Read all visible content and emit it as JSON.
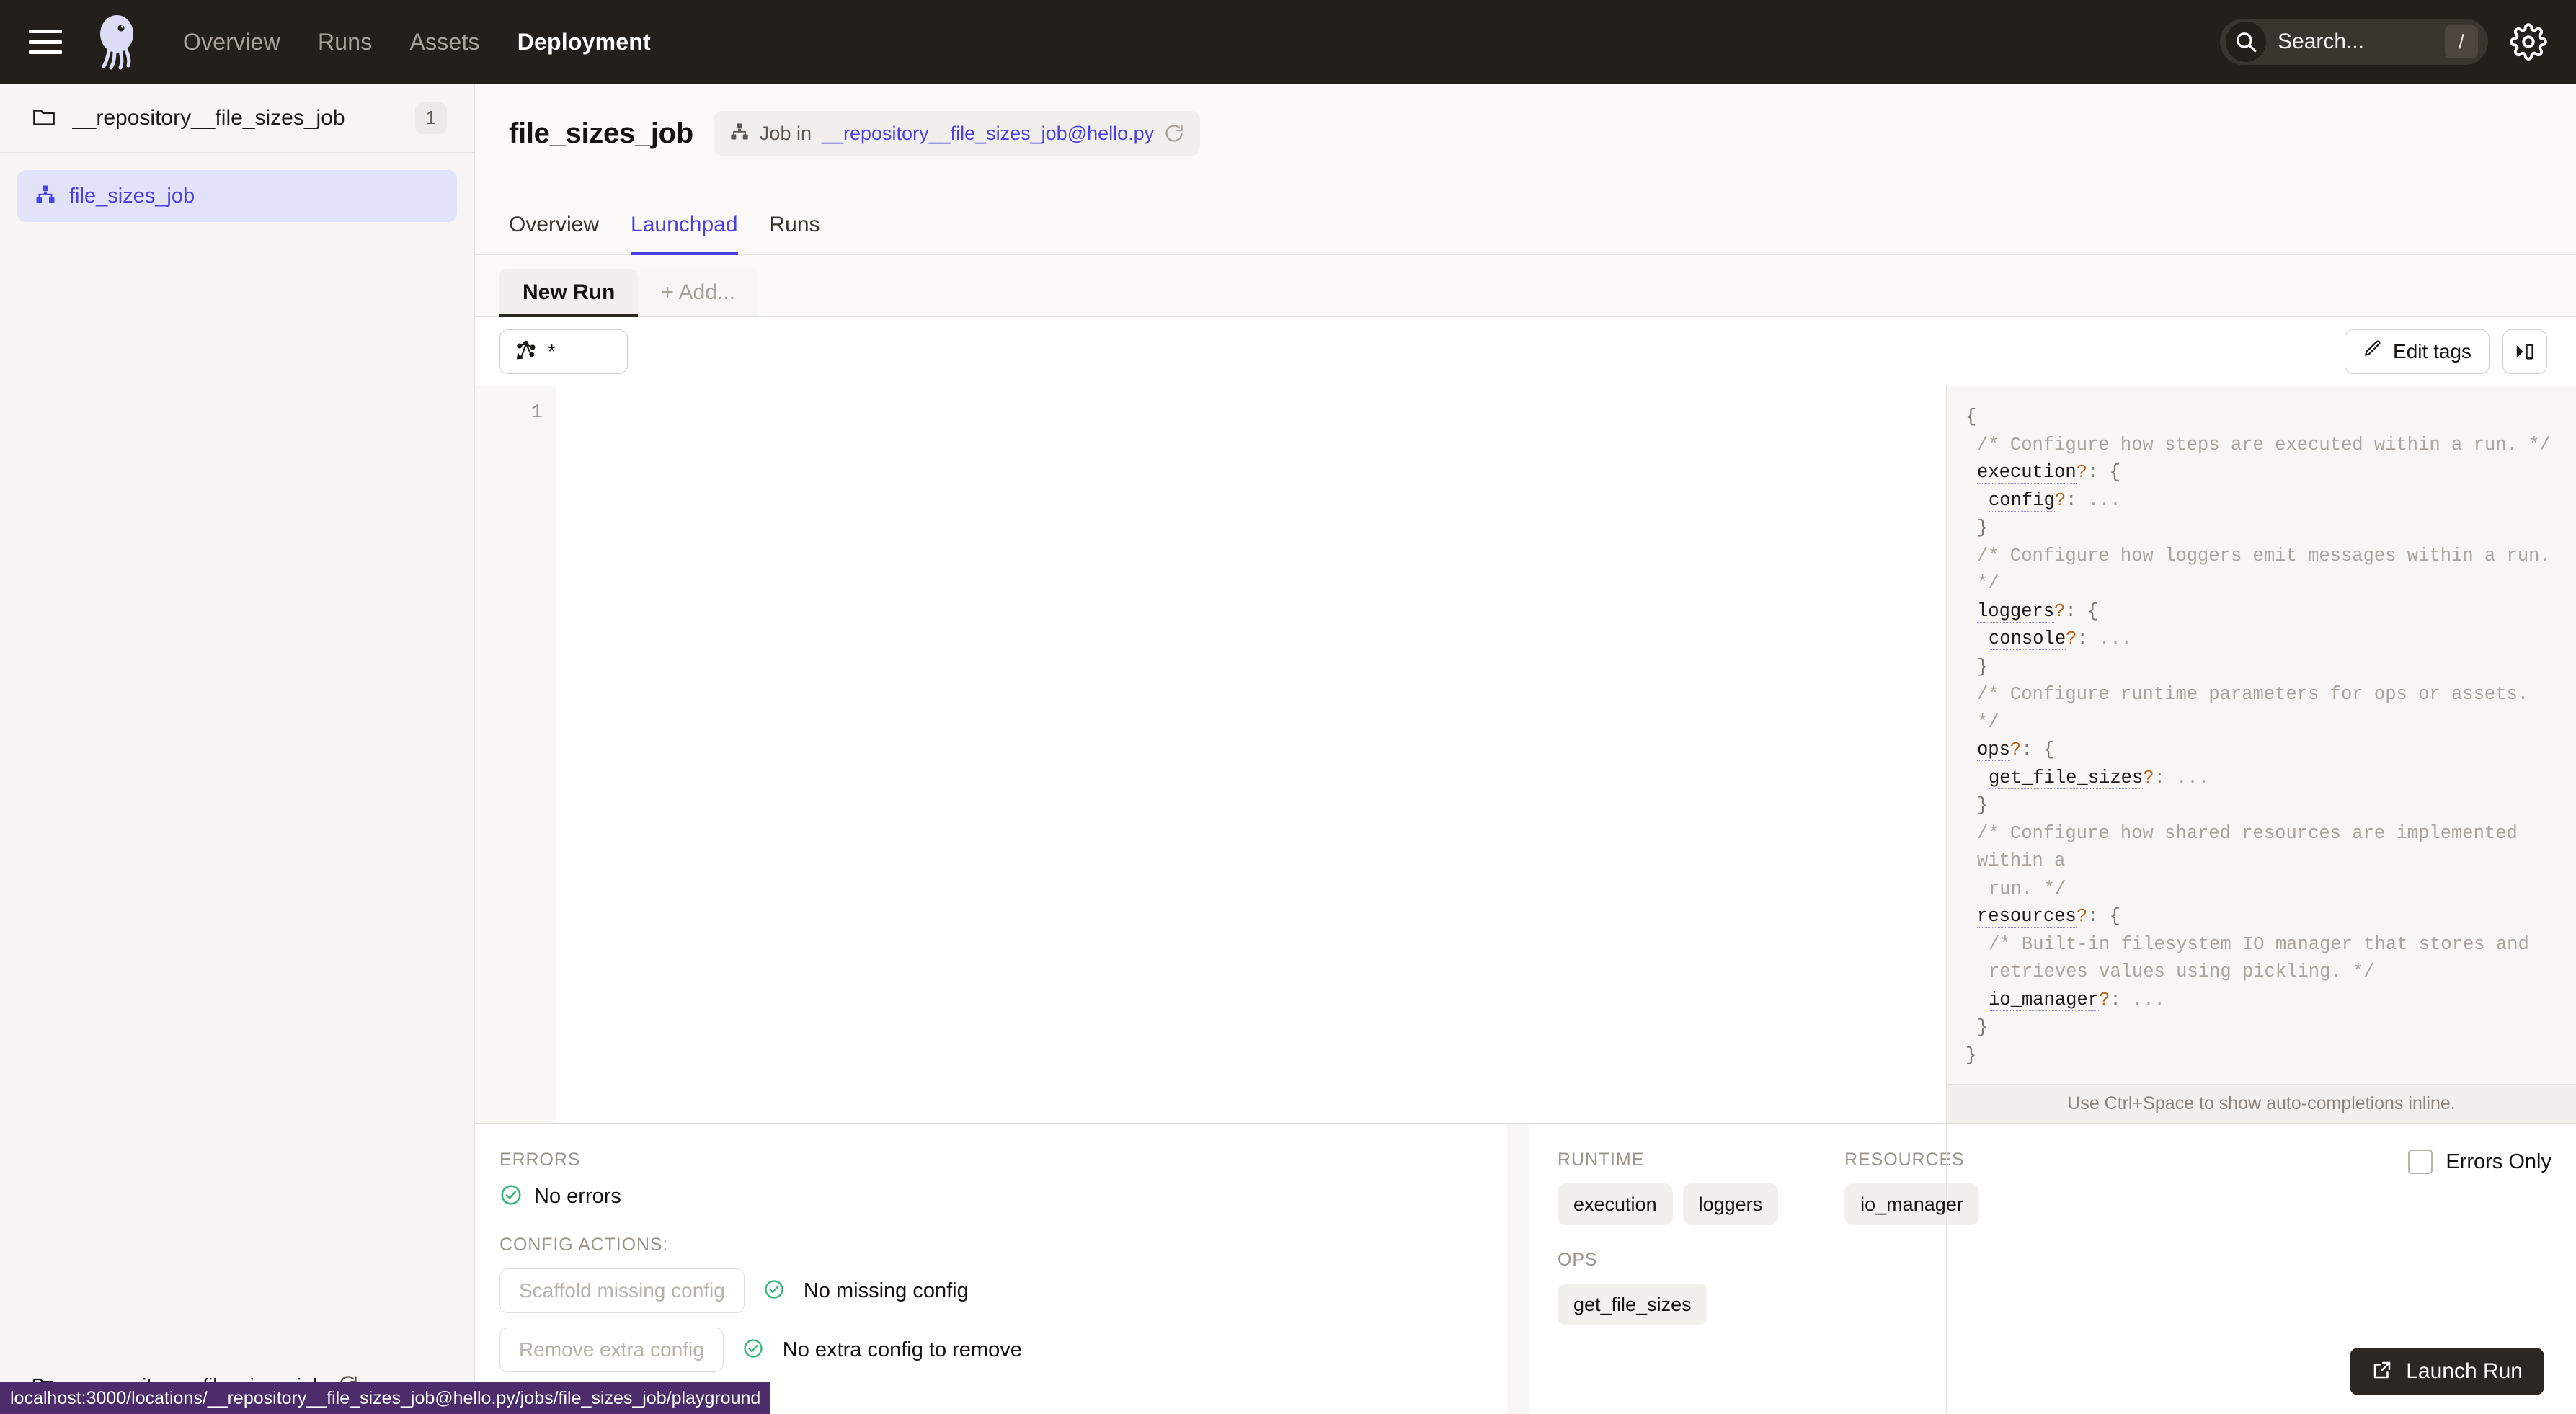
{
  "app": {
    "brand_icon": "dagster-logo-icon",
    "accent": "#4b41e0",
    "dark_bg": "#231f1b"
  },
  "topnav": {
    "menu_icon": "hamburger-menu-icon",
    "links": [
      {
        "label": "Overview",
        "active": false
      },
      {
        "label": "Runs",
        "active": false
      },
      {
        "label": "Assets",
        "active": false
      },
      {
        "label": "Deployment",
        "active": true
      }
    ],
    "search": {
      "icon": "search-icon",
      "placeholder": "Search...",
      "shortcut_key": "/"
    },
    "settings_icon": "gear-icon"
  },
  "sidebar": {
    "repository": {
      "icon": "folder-icon",
      "name": "__repository__file_sizes_job",
      "count": "1"
    },
    "jobs": [
      {
        "icon": "job-graph-icon",
        "label": "file_sizes_job",
        "selected": true
      }
    ],
    "footer": {
      "icon": "folder-icon",
      "label": "__repository__file_sizes_job",
      "reload_icon": "reload-icon"
    }
  },
  "page": {
    "title": "file_sizes_job",
    "subject_chip": {
      "icon": "job-graph-icon",
      "prefix": "Job in ",
      "link": "__repository__file_sizes_job@hello.py",
      "reload_icon": "reload-icon"
    },
    "tabs": [
      {
        "label": "Overview",
        "active": false
      },
      {
        "label": "Launchpad",
        "active": true
      },
      {
        "label": "Runs",
        "active": false
      }
    ]
  },
  "launchpad": {
    "session_tabs": [
      {
        "label": "New Run",
        "active": true
      },
      {
        "label": "+ Add...",
        "active": false
      }
    ],
    "toolbar": {
      "op_selection": {
        "icon": "op-selection-icon",
        "value": "*"
      },
      "edit_tags": {
        "icon": "pencil-icon",
        "label": "Edit tags"
      },
      "toggle_panel": {
        "icon": "collapse-right-panel-icon"
      }
    },
    "editor": {
      "line_numbers": [
        "1"
      ],
      "content": ""
    },
    "schema": {
      "hint": "Use Ctrl+Space to show auto-completions inline.",
      "lines": [
        {
          "indent": 0,
          "parts": [
            {
              "t": "brace",
              "v": "{"
            }
          ]
        },
        {
          "indent": 1,
          "parts": [
            {
              "t": "comment",
              "v": "/* Configure how steps are executed within a run. */"
            }
          ]
        },
        {
          "indent": 1,
          "parts": [
            {
              "t": "key",
              "v": "execution"
            },
            {
              "t": "q",
              "v": "?"
            },
            {
              "t": "punct",
              "v": ": "
            },
            {
              "t": "brace",
              "v": "{"
            }
          ]
        },
        {
          "indent": 2,
          "parts": [
            {
              "t": "key",
              "v": "config"
            },
            {
              "t": "q",
              "v": "?"
            },
            {
              "t": "punct",
              "v": ": "
            },
            {
              "t": "ellipsis",
              "v": "..."
            }
          ]
        },
        {
          "indent": 1,
          "parts": [
            {
              "t": "brace",
              "v": "}"
            }
          ]
        },
        {
          "indent": 1,
          "parts": [
            {
              "t": "comment",
              "v": "/* Configure how loggers emit messages within a run. */"
            }
          ]
        },
        {
          "indent": 1,
          "parts": [
            {
              "t": "key",
              "v": "loggers"
            },
            {
              "t": "q",
              "v": "?"
            },
            {
              "t": "punct",
              "v": ": "
            },
            {
              "t": "brace",
              "v": "{"
            }
          ]
        },
        {
          "indent": 2,
          "parts": [
            {
              "t": "key",
              "v": "console"
            },
            {
              "t": "q",
              "v": "?"
            },
            {
              "t": "punct",
              "v": ": "
            },
            {
              "t": "ellipsis",
              "v": "..."
            }
          ]
        },
        {
          "indent": 1,
          "parts": [
            {
              "t": "brace",
              "v": "}"
            }
          ]
        },
        {
          "indent": 1,
          "parts": [
            {
              "t": "comment",
              "v": "/* Configure runtime parameters for ops or assets. */"
            }
          ]
        },
        {
          "indent": 1,
          "parts": [
            {
              "t": "key",
              "v": "ops"
            },
            {
              "t": "q",
              "v": "?"
            },
            {
              "t": "punct",
              "v": ": "
            },
            {
              "t": "brace",
              "v": "{"
            }
          ]
        },
        {
          "indent": 2,
          "parts": [
            {
              "t": "key",
              "v": "get_file_sizes"
            },
            {
              "t": "q",
              "v": "?"
            },
            {
              "t": "punct",
              "v": ": "
            },
            {
              "t": "ellipsis",
              "v": "..."
            }
          ]
        },
        {
          "indent": 1,
          "parts": [
            {
              "t": "brace",
              "v": "}"
            }
          ]
        },
        {
          "indent": 1,
          "parts": [
            {
              "t": "comment",
              "v": "/* Configure how shared resources are implemented within a"
            }
          ]
        },
        {
          "indent": 2,
          "parts": [
            {
              "t": "comment",
              "v": "run. */"
            }
          ]
        },
        {
          "indent": 1,
          "parts": [
            {
              "t": "key",
              "v": "resources"
            },
            {
              "t": "q",
              "v": "?"
            },
            {
              "t": "punct",
              "v": ": "
            },
            {
              "t": "brace",
              "v": "{"
            }
          ]
        },
        {
          "indent": 2,
          "parts": [
            {
              "t": "comment",
              "v": "/* Built-in filesystem IO manager that stores and"
            }
          ]
        },
        {
          "indent": 2,
          "parts": [
            {
              "t": "comment",
              "v": "retrieves values using pickling. */"
            }
          ]
        },
        {
          "indent": 2,
          "parts": [
            {
              "t": "key",
              "v": "io_manager"
            },
            {
              "t": "q",
              "v": "?"
            },
            {
              "t": "punct",
              "v": ": "
            },
            {
              "t": "ellipsis",
              "v": "..."
            }
          ]
        },
        {
          "indent": 1,
          "parts": [
            {
              "t": "brace",
              "v": "}"
            }
          ]
        },
        {
          "indent": 0,
          "parts": [
            {
              "t": "brace",
              "v": "}"
            }
          ]
        }
      ]
    },
    "errors_panel": {
      "errors_label": "ERRORS",
      "errors_status": "No errors",
      "config_actions_label": "CONFIG ACTIONS:",
      "actions": [
        {
          "button": "Scaffold missing config",
          "status": "No missing config",
          "disabled": true
        },
        {
          "button": "Remove extra config",
          "status": "No extra config to remove",
          "disabled": true
        }
      ]
    },
    "runtime_panel": {
      "runtime_label": "RUNTIME",
      "runtime_chips": [
        "execution",
        "loggers"
      ],
      "resources_label": "RESOURCES",
      "resources_chips": [
        "io_manager"
      ],
      "ops_label": "OPS",
      "ops_chips": [
        "get_file_sizes"
      ],
      "errors_only": {
        "label": "Errors Only",
        "checked": false
      }
    },
    "launch": {
      "icon": "external-link-icon",
      "label": "Launch Run"
    }
  },
  "status_bar": {
    "url": "localhost:3000/locations/__repository__file_sizes_job@hello.py/jobs/file_sizes_job/playground"
  }
}
